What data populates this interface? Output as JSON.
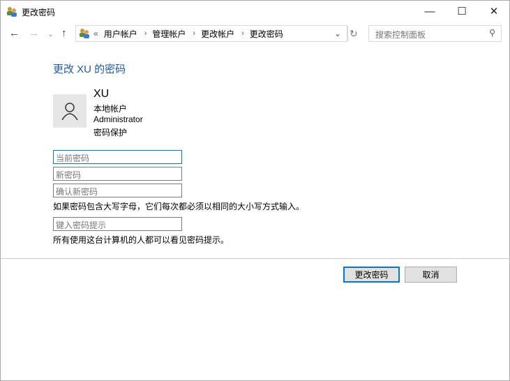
{
  "window": {
    "title": "更改密码"
  },
  "address": {
    "overflow": "«",
    "crumbs": [
      "用户帐户",
      "管理帐户",
      "更改帐户",
      "更改密码"
    ]
  },
  "search": {
    "placeholder": "搜索控制面板"
  },
  "main": {
    "heading": "更改 XU 的密码",
    "user": {
      "name": "XU",
      "type": "本地帐户",
      "role": "Administrator",
      "protection": "密码保护"
    },
    "fields": {
      "current": "当前密码",
      "new": "新密码",
      "confirm": "确认新密码",
      "hint": "键入密码提示"
    },
    "case_note": "如果密码包含大写字母，它们每次都必须以相同的大小写方式输入。",
    "hint_note": "所有使用这台计算机的人都可以看见密码提示。",
    "buttons": {
      "change": "更改密码",
      "cancel": "取消"
    }
  }
}
